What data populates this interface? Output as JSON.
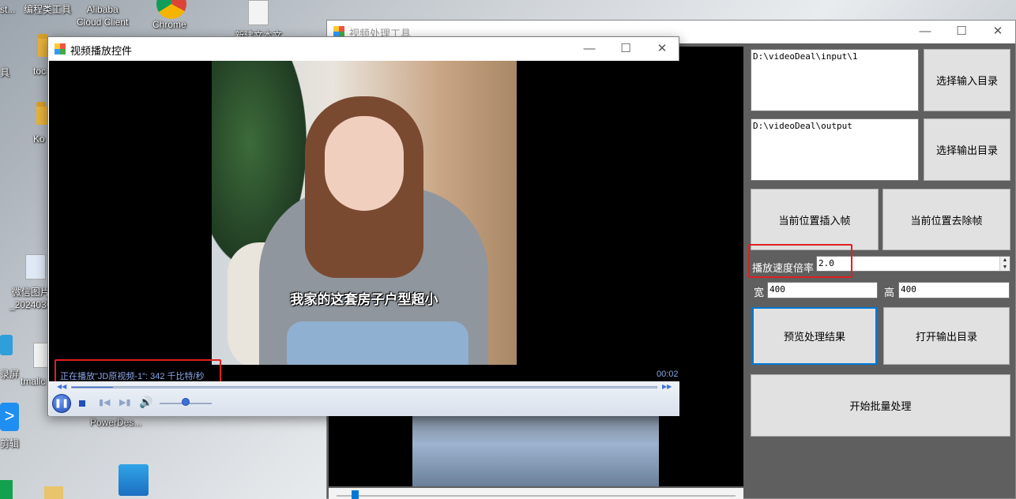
{
  "desktop": {
    "icons": [
      {
        "label": "st..."
      },
      {
        "label": "编程类工具"
      },
      {
        "label": "Alibaba\nCloud Client"
      },
      {
        "label": "Chrome"
      },
      {
        "label": "新建文本文"
      },
      {
        "label": "具"
      },
      {
        "label": "toc"
      },
      {
        "label": "Ko"
      },
      {
        "label": "微信图片\n_2024030"
      },
      {
        "label": "录屏"
      },
      {
        "label": "tmallc"
      },
      {
        "label": "剪辑"
      },
      {
        "label": "PowerDes..."
      }
    ]
  },
  "tool": {
    "title": "视频处理工具",
    "input_dir": "D:\\videoDeal\\input\\1",
    "output_dir": "D:\\videoDeal\\output",
    "select_input_label": "选择输入目录",
    "select_output_label": "选择输出目录",
    "insert_frame_label": "当前位置插入帧",
    "remove_frame_label": "当前位置去除帧",
    "speed_label": "播放速度倍率",
    "speed_value": "2.0",
    "width_label": "宽",
    "width_value": "400",
    "height_label": "高",
    "height_value": "400",
    "preview_label": "预览处理结果",
    "open_output_label": "打开输出目录",
    "batch_label": "开始批量处理"
  },
  "player": {
    "title": "视频播放控件",
    "subtitle": "我家的这套房子户型超小",
    "status": "正在播放\"JD原视频-1\": 342 千比特/秒",
    "time": "00:02",
    "progress": 0.07,
    "volume": 0.5
  },
  "taskbar_icons": [
    "minimize-icon",
    "maximize-icon",
    "close-icon"
  ]
}
